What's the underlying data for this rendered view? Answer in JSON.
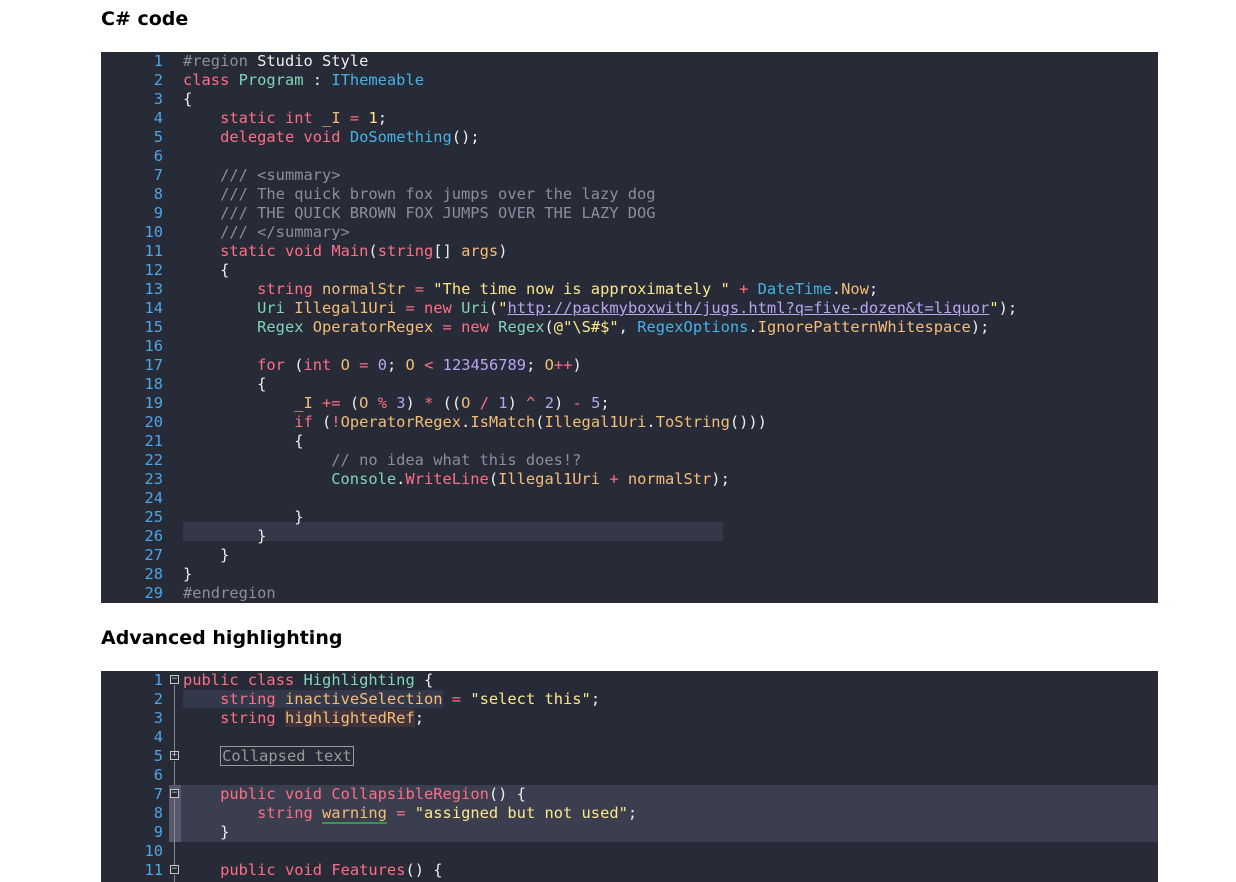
{
  "sections": {
    "csharp_title": "C# code",
    "advanced_title": "Advanced highlighting"
  },
  "csharp": {
    "line_numbers": [
      "1",
      "2",
      "3",
      "4",
      "5",
      "6",
      "7",
      "8",
      "9",
      "10",
      "11",
      "12",
      "13",
      "14",
      "15",
      "16",
      "17",
      "18",
      "19",
      "20",
      "21",
      "22",
      "23",
      "24",
      "25",
      "26",
      "27",
      "28",
      "29"
    ],
    "l1": {
      "a": "#region",
      "b": " Studio Style"
    },
    "l2": {
      "a": "class",
      "b": " ",
      "c": "Program",
      "d": " : ",
      "e": "IThemeable"
    },
    "l3": {
      "a": "{"
    },
    "l4": {
      "a": "    ",
      "b": "static",
      "c": " ",
      "d": "int",
      "e": " ",
      "f": "_I",
      "g": " ",
      "h": "=",
      "i": " ",
      "j": "1",
      "k": ";"
    },
    "l5": {
      "a": "    ",
      "b": "delegate",
      "c": " ",
      "d": "void",
      "e": " ",
      "f": "DoSomething",
      "g": "();"
    },
    "l7": {
      "a": "    ",
      "b": "/// <summary>"
    },
    "l8": {
      "a": "    ",
      "b": "/// The quick brown fox jumps over the lazy dog"
    },
    "l9": {
      "a": "    ",
      "b": "/// THE QUICK BROWN FOX JUMPS OVER THE LAZY DOG"
    },
    "l10": {
      "a": "    ",
      "b": "/// </summary>"
    },
    "l11": {
      "a": "    ",
      "b": "static",
      "c": " ",
      "d": "void",
      "e": " ",
      "f": "Main",
      "g": "(",
      "h": "string",
      "i": "[] ",
      "j": "args",
      "k": ")"
    },
    "l12": {
      "a": "    {"
    },
    "l13": {
      "a": "        ",
      "b": "string",
      "c": " ",
      "d": "normalStr",
      "e": " ",
      "f": "=",
      "g": " ",
      "h": "\"The time now is approximately \"",
      "i": " ",
      "j": "+",
      "k": " ",
      "l": "DateTime",
      "m": ".",
      "n": "Now",
      "o": ";"
    },
    "l14": {
      "a": "        ",
      "b": "Uri",
      "c": " ",
      "d": "Illegal1Uri",
      "e": " ",
      "f": "=",
      "g": " ",
      "h": "new",
      "i": " ",
      "j": "Uri",
      "k": "(",
      "l": "\"",
      "m": "http://packmyboxwith/jugs.html?q=five-dozen&t=liquor",
      "n": "\"",
      "o": ");"
    },
    "l15": {
      "a": "        ",
      "b": "Regex",
      "c": " ",
      "d": "OperatorRegex",
      "e": " ",
      "f": "=",
      "g": " ",
      "h": "new",
      "i": " ",
      "j": "Regex",
      "k": "(",
      "l": "@\"\\S#$\"",
      "m": ", ",
      "n": "RegexOptions",
      "o": ".",
      "p": "IgnorePatternWhitespace",
      "q": ");"
    },
    "l17": {
      "a": "        ",
      "b": "for",
      "c": " (",
      "d": "int",
      "e": " ",
      "f": "O",
      "g": " ",
      "h": "=",
      "i": " ",
      "j": "0",
      "k": "; ",
      "l": "O",
      "m": " ",
      "n": "<",
      "o": " ",
      "p": "123456789",
      "q": "; ",
      "r": "O",
      "s": "++",
      "t": ")"
    },
    "l18": {
      "a": "        {"
    },
    "l19": {
      "a": "            ",
      "b": "_I",
      "c": " ",
      "d": "+=",
      "e": " (",
      "f": "O",
      "g": " ",
      "h": "%",
      "i": " ",
      "j": "3",
      "k": ") ",
      "l": "*",
      "m": " ((",
      "n": "O",
      "o": " ",
      "p": "/",
      "q": " ",
      "r": "1",
      "s": ") ",
      "t": "^",
      "u": " ",
      "v": "2",
      "w": ") ",
      "x": "-",
      "y": " ",
      "z": "5",
      "zz": ";"
    },
    "l20": {
      "a": "            ",
      "b": "if",
      "c": " (",
      "d": "!",
      "e": "OperatorRegex",
      "f": ".",
      "g": "IsMatch",
      "h": "(",
      "i": "Illegal1Uri",
      "j": ".",
      "k": "ToString",
      "l": "()))"
    },
    "l21": {
      "a": "            {"
    },
    "l22": {
      "a": "                ",
      "b": "// no idea what this does!?"
    },
    "l23": {
      "a": "                ",
      "b": "Console",
      "c": ".",
      "d": "WriteLine",
      "e": "(",
      "f": "Illegal1Uri",
      "g": " ",
      "h": "+",
      "i": " ",
      "j": "normalStr",
      "k": ");"
    },
    "l25": {
      "a": "            }"
    },
    "l26": {
      "a": "        }"
    },
    "l27": {
      "a": "    }"
    },
    "l28": {
      "a": "}"
    },
    "l29": {
      "a": "#endregion"
    }
  },
  "advanced": {
    "line_numbers": [
      "1",
      "2",
      "3",
      "4",
      "5",
      "6",
      "7",
      "8",
      "9",
      "10",
      "11"
    ],
    "fold_expanded": "−",
    "fold_collapsed": "+",
    "l1": {
      "a": "public",
      "b": " ",
      "c": "class",
      "d": " ",
      "e": "Highlighting",
      "f": " {"
    },
    "l2": {
      "a": "    ",
      "b": "string",
      "c": " ",
      "d": "inactiveSelection",
      "e": " ",
      "f": "=",
      "g": " ",
      "h": "\"select this\"",
      "i": ";"
    },
    "l3": {
      "a": "    ",
      "b": "string",
      "c": " ",
      "d": "highlightedRef",
      "e": ";"
    },
    "l5": {
      "a": "    ",
      "b": "Collapsed text"
    },
    "l7": {
      "a": "    ",
      "b": "public",
      "c": " ",
      "d": "void",
      "e": " ",
      "f": "CollapsibleRegion",
      "g": "() {"
    },
    "l8": {
      "a": "        ",
      "b": "string",
      "c": " ",
      "d": "warning",
      "e": " ",
      "f": "=",
      "g": " ",
      "h": "\"assigned but not used\"",
      "i": ";"
    },
    "l9": {
      "a": "    }"
    },
    "l11": {
      "a": "    ",
      "b": "public",
      "c": " ",
      "d": "void",
      "e": " ",
      "f": "Features",
      "g": "() {"
    }
  }
}
